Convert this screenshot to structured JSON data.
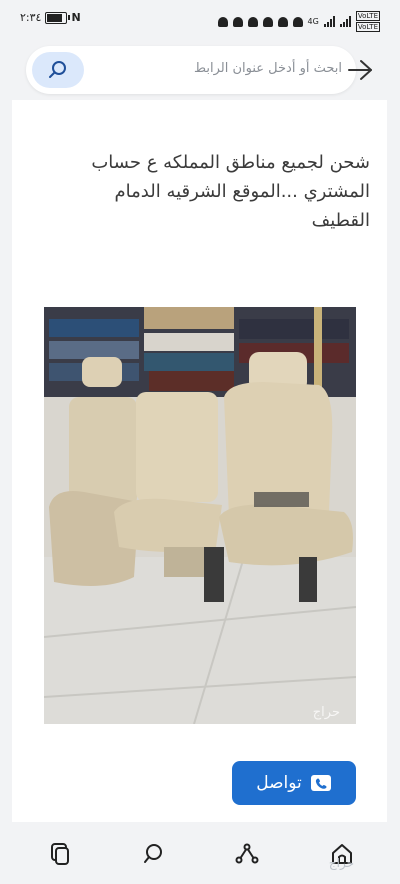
{
  "status_bar": {
    "time": "٢:٣٤",
    "battery_level": 0.85,
    "network_label": "4G",
    "sim1_label": "VoLTE",
    "sim2_label": "VoLTE"
  },
  "search": {
    "placeholder": "ابحث أو أدخل عنوان الرابط",
    "search_icon": "search-icon",
    "back_icon": "arrow-right-icon"
  },
  "post": {
    "text": "شحن لجميع مناطق المملكه ع حساب المشتري ...الموقع الشرقيه الدمام القطيف",
    "image_alt": "car seats",
    "watermark": "حراج"
  },
  "contact_button": {
    "label": "تواصل",
    "icon": "phone-icon"
  },
  "bottom_nav": {
    "items": [
      {
        "icon": "copy-icon"
      },
      {
        "icon": "search-icon"
      },
      {
        "icon": "share-icon"
      },
      {
        "icon": "home-icon"
      }
    ],
    "watermark": "حراج"
  },
  "colors": {
    "accent": "#1f6fcf",
    "search_button_bg": "#dbe8fb",
    "background": "#f2f3f5"
  }
}
